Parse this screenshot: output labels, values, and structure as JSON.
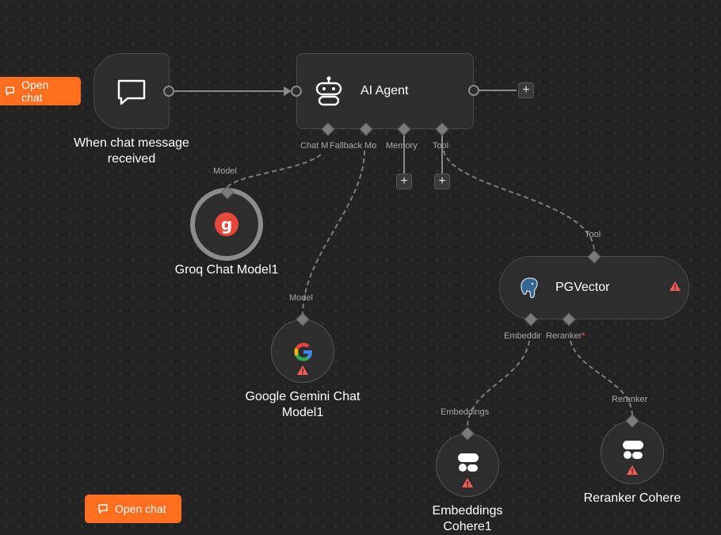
{
  "canvas": {
    "background": "#232323",
    "accent": "#ff6d1f",
    "warning_color": "#ff5a5a"
  },
  "open_chat_buttons": [
    {
      "label": "Open chat",
      "icon": "chat-bubble-icon"
    },
    {
      "label": "Open chat",
      "icon": "chat-bubble-icon"
    }
  ],
  "nodes": {
    "trigger": {
      "title_line1": "When chat message",
      "title_line2": "received",
      "icon": "chat-bubble-icon"
    },
    "agent": {
      "title": "AI Agent",
      "icon": "robot-icon",
      "ports": [
        "Chat M",
        "Fallback Mo",
        "Memory",
        "Tool"
      ]
    },
    "groq": {
      "title": "Groq Chat Model1",
      "port_label": "Model",
      "icon": "groq-logo-icon"
    },
    "gemini": {
      "title_line1": "Google Gemini Chat",
      "title_line2": "Model1",
      "port_label": "Model",
      "icon": "google-logo-icon",
      "warning": true
    },
    "pgvector": {
      "title": "PGVector",
      "port_label": "Tool",
      "icon": "postgres-elephant-icon",
      "warning": true,
      "ports": [
        "Embeddir",
        "Reranker",
        "*"
      ]
    },
    "embeddings": {
      "title_line1": "Embeddings",
      "title_line2": "Cohere1",
      "port_label": "Embeddings",
      "icon": "cohere-logo-icon",
      "warning": true
    },
    "reranker": {
      "title": "Reranker Cohere",
      "port_label": "Reranker",
      "icon": "cohere-logo-icon",
      "warning": true
    }
  },
  "add_button_label": "+"
}
